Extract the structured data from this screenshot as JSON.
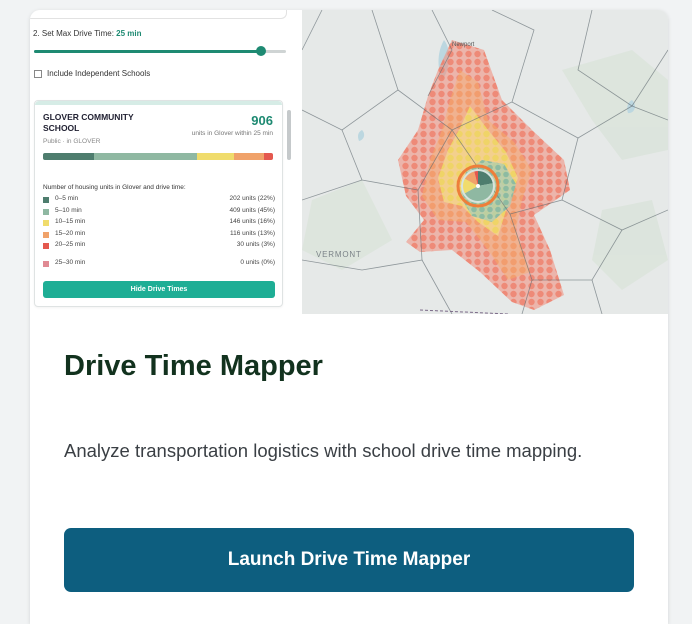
{
  "preview": {
    "step_label_prefix": "2. Set Max Drive Time: ",
    "step_value": "25 min",
    "slider_fraction": 0.9,
    "checkbox_label": "Include Independent Schools",
    "checkbox_checked": false,
    "school": {
      "name": "GLOVER COMMUNITY SCHOOL",
      "subtitle": "Public · in GLOVER",
      "count": "906",
      "count_label": "units in Glover within 25 min"
    },
    "stack_segments": [
      {
        "fraction": 0.22,
        "color": "#4e7d6e"
      },
      {
        "fraction": 0.45,
        "color": "#8fb8a2"
      },
      {
        "fraction": 0.16,
        "color": "#f0dc6c"
      },
      {
        "fraction": 0.13,
        "color": "#f0a26a"
      },
      {
        "fraction": 0.04,
        "color": "#e4584e"
      }
    ],
    "legend_title": "Number of housing units in Glover and drive time:",
    "legend": [
      {
        "label": "0–5 min",
        "amount": "202 units (22%)",
        "color": "#4e7d6e"
      },
      {
        "label": "5–10 min",
        "amount": "409 units (45%)",
        "color": "#8fb8a2"
      },
      {
        "label": "10–15 min",
        "amount": "146 units (16%)",
        "color": "#f0dc6c"
      },
      {
        "label": "15–20 min",
        "amount": "116 units (13%)",
        "color": "#f0a26a"
      },
      {
        "label": "20–25 min",
        "amount": "30 units (3%)",
        "color": "#e4584e"
      },
      {
        "label": "25–30 min",
        "amount": "0 units (0%)",
        "color": "#e08a93"
      }
    ],
    "hide_button": "Hide Drive Times",
    "map_labels": {
      "state": "VERMONT",
      "town": "Newport"
    }
  },
  "card": {
    "title": "Drive Time Mapper",
    "description": "Analyze transportation logistics with school drive time mapping.",
    "launch_button": "Launch Drive Time Mapper"
  },
  "colors": {
    "accent_green": "#1e8a72",
    "button_teal": "#1eae95",
    "launch_blue": "#0d5e7f",
    "title_green": "#12321e"
  }
}
